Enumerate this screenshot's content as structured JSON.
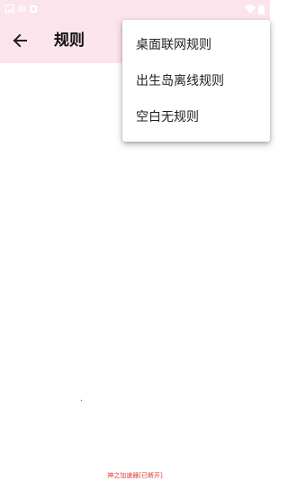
{
  "status_bar": {
    "left_text": "30",
    "icons": [
      "image-icon",
      "notification-icon",
      "wifi-icon",
      "battery-icon"
    ]
  },
  "app_bar": {
    "title": "规则",
    "back_icon": "arrow-left-icon",
    "background": "#fce4ec"
  },
  "menu": {
    "items": [
      {
        "label": "桌面联网规则"
      },
      {
        "label": "出生岛离线规则"
      },
      {
        "label": "空白无规则"
      }
    ]
  },
  "footer": {
    "text": "神之加速器[已断开]",
    "color": "#e53935"
  }
}
